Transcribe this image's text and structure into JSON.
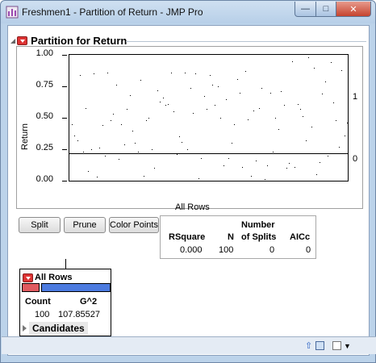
{
  "window": {
    "title": "Freshmen1 - Partition of Return - JMP Pro",
    "minimize_glyph": "—",
    "maximize_glyph": "□",
    "close_glyph": "✕"
  },
  "report": {
    "title": "Partition for Return",
    "plot": {
      "y_axis_label": "Return",
      "y_ticks": [
        "1.00",
        "0.75",
        "0.50",
        "0.25",
        "0.00"
      ],
      "x_axis_label": "All Rows",
      "right_labels": [
        "1",
        "0"
      ]
    },
    "buttons": {
      "split": "Split",
      "prune": "Prune",
      "color_points": "Color Points"
    },
    "summary": {
      "header_number": "Number",
      "header_rsquare": "RSquare",
      "header_n": "N",
      "header_splits": "of Splits",
      "header_aicc": "AICc",
      "rsquare": "0.000",
      "n": "100",
      "splits": "0",
      "aicc": "0"
    },
    "node": {
      "title": "All Rows",
      "count_label": "Count",
      "g2_label": "G^2",
      "count": "100",
      "g2": "107.85527",
      "candidates": "Candidates",
      "bar_colors": [
        "#e05a5f",
        "#4c7be0"
      ]
    }
  },
  "chart_data": {
    "type": "scatter",
    "xlabel": "All Rows",
    "ylabel": "Return",
    "ylim": [
      0,
      1
    ],
    "y_ticks": [
      0,
      0.25,
      0.5,
      0.75,
      1
    ],
    "split_line_y": 0.22,
    "points": [
      [
        0.0,
        0.45
      ],
      [
        0.01,
        0.36
      ],
      [
        0.02,
        0.32
      ],
      [
        0.03,
        0.84
      ],
      [
        0.04,
        0.23
      ],
      [
        0.05,
        0.58
      ],
      [
        0.06,
        0.08
      ],
      [
        0.07,
        0.25
      ],
      [
        0.08,
        0.85
      ],
      [
        0.09,
        0.03
      ],
      [
        0.1,
        0.26
      ],
      [
        0.11,
        0.44
      ],
      [
        0.12,
        0.2
      ],
      [
        0.13,
        0.86
      ],
      [
        0.14,
        0.48
      ],
      [
        0.15,
        0.53
      ],
      [
        0.16,
        0.76
      ],
      [
        0.17,
        0.17
      ],
      [
        0.18,
        0.45
      ],
      [
        0.19,
        0.29
      ],
      [
        0.2,
        0.57
      ],
      [
        0.21,
        0.68
      ],
      [
        0.22,
        0.4
      ],
      [
        0.23,
        0.3
      ],
      [
        0.24,
        0.23
      ],
      [
        0.25,
        0.8
      ],
      [
        0.26,
        0.04
      ],
      [
        0.27,
        0.48
      ],
      [
        0.28,
        0.5
      ],
      [
        0.29,
        0.25
      ],
      [
        0.3,
        0.1
      ],
      [
        0.31,
        0.72
      ],
      [
        0.32,
        0.63
      ],
      [
        0.33,
        0.66
      ],
      [
        0.34,
        0.6
      ],
      [
        0.35,
        0.61
      ],
      [
        0.36,
        0.86
      ],
      [
        0.37,
        0.55
      ],
      [
        0.38,
        0.21
      ],
      [
        0.39,
        0.35
      ],
      [
        0.4,
        0.31
      ],
      [
        0.41,
        0.86
      ],
      [
        0.42,
        0.25
      ],
      [
        0.43,
        0.74
      ],
      [
        0.44,
        0.54
      ],
      [
        0.45,
        0.85
      ],
      [
        0.46,
        0.02
      ],
      [
        0.47,
        0.18
      ],
      [
        0.48,
        0.67
      ],
      [
        0.49,
        0.57
      ],
      [
        0.5,
        0.84
      ],
      [
        0.51,
        0.76
      ],
      [
        0.52,
        0.6
      ],
      [
        0.53,
        0.75
      ],
      [
        0.54,
        0.5
      ],
      [
        0.55,
        0.12
      ],
      [
        0.56,
        0.65
      ],
      [
        0.57,
        0.18
      ],
      [
        0.58,
        0.3
      ],
      [
        0.59,
        0.45
      ],
      [
        0.6,
        0.81
      ],
      [
        0.61,
        0.7
      ],
      [
        0.62,
        0.11
      ],
      [
        0.63,
        0.87
      ],
      [
        0.64,
        0.49
      ],
      [
        0.65,
        0.04
      ],
      [
        0.66,
        0.56
      ],
      [
        0.67,
        0.16
      ],
      [
        0.68,
        0.58
      ],
      [
        0.69,
        0.74
      ],
      [
        0.7,
        0.01
      ],
      [
        0.71,
        0.12
      ],
      [
        0.72,
        0.7
      ],
      [
        0.73,
        0.23
      ],
      [
        0.74,
        0.5
      ],
      [
        0.75,
        0.41
      ],
      [
        0.76,
        0.71
      ],
      [
        0.77,
        0.6
      ],
      [
        0.78,
        0.1
      ],
      [
        0.79,
        0.14
      ],
      [
        0.8,
        0.95
      ],
      [
        0.81,
        0.11
      ],
      [
        0.82,
        0.61
      ],
      [
        0.83,
        0.57
      ],
      [
        0.84,
        0.51
      ],
      [
        0.85,
        0.32
      ],
      [
        0.86,
        0.98
      ],
      [
        0.87,
        0.43
      ],
      [
        0.88,
        0.9
      ],
      [
        0.89,
        0.05
      ],
      [
        0.9,
        0.15
      ],
      [
        0.91,
        0.69
      ],
      [
        0.92,
        0.79
      ],
      [
        0.93,
        0.2
      ],
      [
        0.94,
        0.94
      ],
      [
        0.95,
        0.62
      ],
      [
        0.96,
        0.48
      ],
      [
        0.97,
        0.27
      ],
      [
        0.98,
        0.88
      ],
      [
        0.99,
        0.36
      ],
      [
        1.0,
        0.46
      ]
    ]
  },
  "statusbar": {
    "icon_up": "⇧",
    "icon_menu": "▼"
  }
}
